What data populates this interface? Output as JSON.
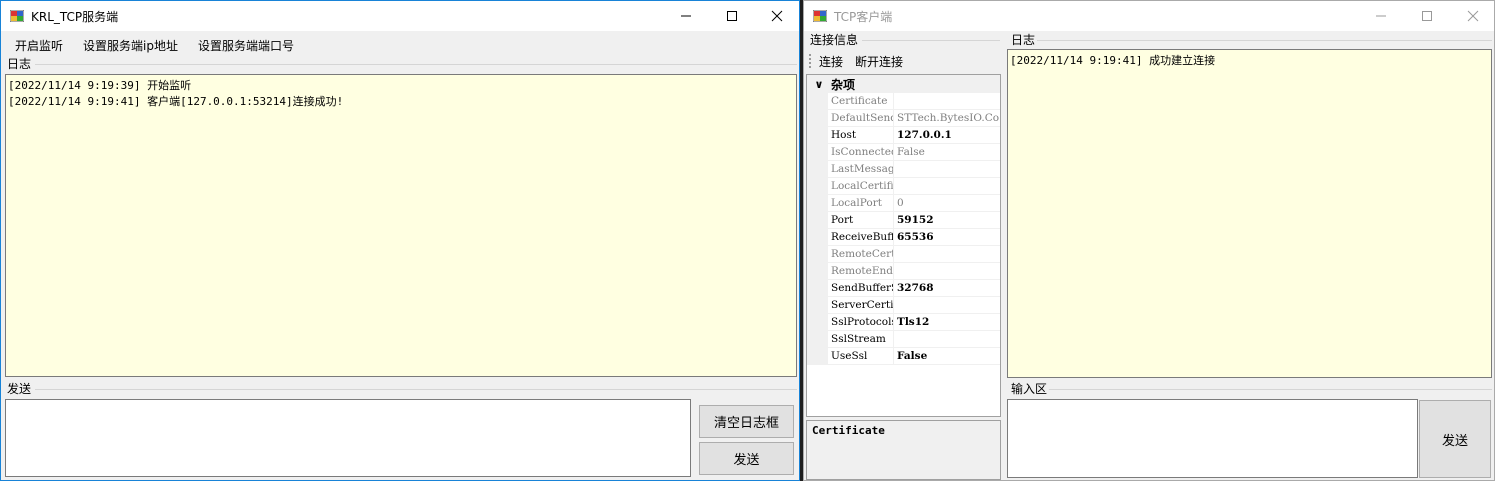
{
  "server": {
    "title": "KRL_TCP服务端",
    "menu": [
      "开启监听",
      "设置服务端ip地址",
      "设置服务端端口号"
    ],
    "log_label": "日志",
    "log_lines": [
      "[2022/11/14 9:19:39] 开始监听",
      "[2022/11/14 9:19:41] 客户端[127.0.0.1:53214]连接成功!"
    ],
    "send_label": "发送",
    "clear_button": "清空日志框",
    "send_button": "发送"
  },
  "client": {
    "title": "TCP客户端",
    "conn_info_label": "连接信息",
    "connect_button": "连接",
    "disconnect_button": "断开连接",
    "category": "杂项",
    "properties": [
      {
        "name": "Certificate",
        "value": "",
        "set": false
      },
      {
        "name": "DefaultSender",
        "value": "STTech.BytesIO.Co",
        "set": false
      },
      {
        "name": "Host",
        "value": "127.0.0.1",
        "set": true
      },
      {
        "name": "IsConnected",
        "value": "False",
        "set": false
      },
      {
        "name": "LastMessage",
        "value": "",
        "set": false
      },
      {
        "name": "LocalCertificate",
        "value": "",
        "set": false
      },
      {
        "name": "LocalPort",
        "value": "0",
        "set": false
      },
      {
        "name": "Port",
        "value": "59152",
        "set": true
      },
      {
        "name": "ReceiveBufferSize",
        "value": "65536",
        "set": true
      },
      {
        "name": "RemoteCertificate",
        "value": "",
        "set": false
      },
      {
        "name": "RemoteEndPoint",
        "value": "",
        "set": false
      },
      {
        "name": "SendBufferSize",
        "value": "32768",
        "set": true
      },
      {
        "name": "ServerCertificate",
        "value": "",
        "set": true
      },
      {
        "name": "SslProtocols",
        "value": "Tls12",
        "set": true
      },
      {
        "name": "SslStream",
        "value": "",
        "set": true
      },
      {
        "name": "UseSsl",
        "value": "False",
        "set": true
      }
    ],
    "description_title": "Certificate",
    "log_label": "日志",
    "log_lines": [
      "[2022/11/14 9:19:41] 成功建立连接"
    ],
    "input_label": "输入区",
    "send_button": "发送"
  },
  "colors": {
    "log_background": "#ffffe1",
    "active_border": "#1883d7"
  },
  "icons": {
    "app": "app-icon",
    "minimize": "minimize-icon",
    "maximize": "maximize-icon",
    "close": "close-icon",
    "expand": "chevron-down-icon"
  }
}
